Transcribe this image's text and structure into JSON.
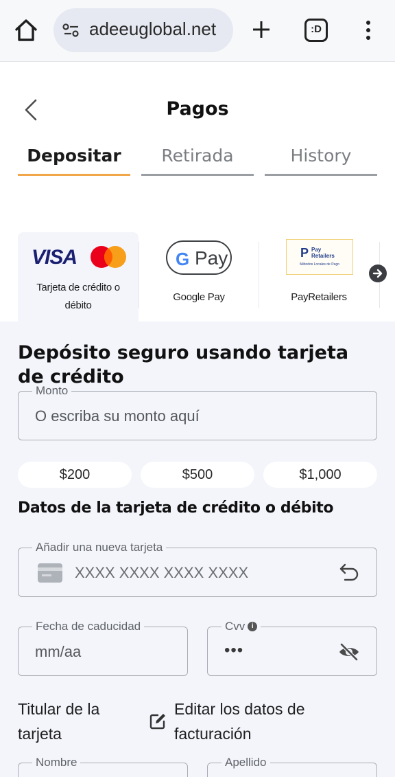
{
  "browser": {
    "url": "adeeuglobal.net",
    "tabs_icon_label": ":D",
    "icons": [
      "home-icon",
      "site-settings-icon",
      "plus-icon",
      "tab-switcher-icon",
      "more-vert-icon"
    ]
  },
  "header": {
    "title": "Pagos",
    "back_icon": "chevron-left-icon"
  },
  "tabs": [
    {
      "label": "Depositar",
      "active": true
    },
    {
      "label": "Retirada",
      "active": false
    },
    {
      "label": "History",
      "active": false
    }
  ],
  "payment_methods": [
    {
      "label": "Tarjeta de crédito o débito",
      "logo": "visa-mastercard",
      "selected": true
    },
    {
      "label": "Google Pay",
      "logo": "google-pay",
      "selected": false
    },
    {
      "label": "PayRetailers",
      "logo": "payretailers",
      "selected": false
    }
  ],
  "logos": {
    "visa_text": "VISA",
    "gpay_g": "G",
    "gpay_text": "Pay",
    "payretailers_mark": "P",
    "payretailers_words": "Pay Retailers",
    "payretailers_sub": "Métodos Locales de Pago"
  },
  "deposit": {
    "title": "Depósito seguro usando tarjeta de crédito",
    "amount_legend": "Monto",
    "amount_placeholder": "O escriba su monto aquí",
    "quick_amounts": [
      "$200",
      "$500",
      "$1,000"
    ]
  },
  "card": {
    "section_title": "Datos de la tarjeta de crédito o débito",
    "new_card_legend": "Añadir una nueva tarjeta",
    "card_number_placeholder": "XXXX XXXX XXXX XXXX",
    "expiry_legend": "Fecha de caducidad",
    "expiry_placeholder": "mm/aa",
    "cvv_legend": "Cvv",
    "cvv_value": "•••",
    "holder_label": "Titular de la tarjeta",
    "edit_billing_label": "Editar los datos de facturación",
    "first_name_legend": "Nombre",
    "last_name_legend": "Apellido"
  },
  "colors": {
    "accent": "#f2a64a",
    "form_background": "#f3f5fb",
    "visa_blue": "#1a1f71"
  }
}
